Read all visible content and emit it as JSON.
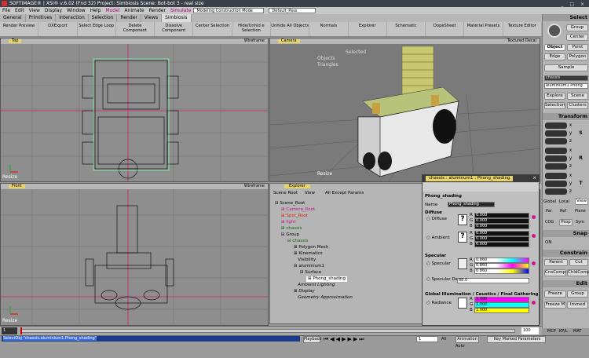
{
  "window": {
    "title": "SOFTIMAGE® | XSI® v.6.02 (Fnd 32) Project: Simbiosis    Scene: Bot-bot 3 - real size"
  },
  "menu": {
    "items": [
      "File",
      "Edit",
      "View",
      "Display",
      "Window",
      "Help",
      "Model",
      "Animate",
      "Render",
      "Simulate"
    ],
    "mode": "Modeling Construction Mode",
    "pass": "Default_Pass"
  },
  "tabs": [
    "General",
    "Primitives",
    "Interaction",
    "Selection",
    "Render",
    "Views",
    "Simbiosis"
  ],
  "toolbar": [
    "Render Preview",
    "DXExport",
    "Select Edge Loop",
    "Delete Component",
    "Dissolve Component",
    "Center Selection",
    "Hide/Unhid e Selection",
    "Unhide All Objects",
    "Normals",
    "Explorer",
    "Schematic",
    "DopeSheet",
    "Material Presets",
    "Texture Editor"
  ],
  "viewports": {
    "top": {
      "name": "Top",
      "mode": "Wireframe",
      "letter": "Resize"
    },
    "camera": {
      "name": "Camera",
      "mode": "Textured Decal",
      "stats": [
        "Selected",
        "Objects",
        "Triangles"
      ],
      "letter": "Resize"
    },
    "front": {
      "name": "Front",
      "mode": "Wireframe",
      "letter": "Resize"
    }
  },
  "explorer": {
    "tabs": [
      "Explorer",
      "Scene Root",
      "View",
      "All Except Params"
    ],
    "nodes": [
      "Scene_Root",
      "Camera_Root",
      "Spot_Root",
      "light",
      "chassis",
      "Group",
      "chassis",
      "Polygon Mesh",
      "Kinematics",
      "Visibility",
      "aluminium1",
      "Surface",
      "Phong_shading",
      "Ambient Lighting",
      "Display",
      "Geometry Approximation"
    ]
  },
  "prop": {
    "title": "chassis : aluminum1 : Phong_shading",
    "subtitle": "Phong_shading",
    "name_label": "Name",
    "name_value": "Phong_shading",
    "diffuse": "Diffuse",
    "diffuse_label": "Diffuse",
    "ambient_label": "Ambient",
    "specular": "Specular",
    "specular_label": "Specular",
    "decay_label": "Specular Decay",
    "decay_value": "88.0",
    "gi": "Global Illumination / Caustics / Final Gathering",
    "radiance_label": "Radiance",
    "rgb": [
      "R",
      "G",
      "B"
    ],
    "zeros": [
      "0.000",
      "0.000",
      "0.000"
    ],
    "spec_vals": [
      "0.860",
      "0.860",
      "0.860"
    ],
    "rad_vals": [
      "1.000",
      "1.000",
      "1.000"
    ]
  },
  "right_panel": {
    "select": "Select",
    "group": "Group",
    "center": "Center",
    "object": "Object",
    "point": "Point",
    "edge": "Edge",
    "polygon": "Polygon",
    "sample": "Sample",
    "sel_name": "chassis",
    "sel_mat": "aluminium1 Phong",
    "explore": "Explore",
    "scene": "Scene",
    "selection": "Selection",
    "clusters": "Clusters",
    "transform": "Transform",
    "axes": [
      "x",
      "y",
      "z"
    ],
    "tr": [
      "S",
      "R",
      "T"
    ],
    "global": "Global",
    "local": "Local",
    "view": "View",
    "par": "Par",
    "ref": "Ref",
    "plane": "Plane",
    "cog": "COG",
    "prop_btn": "Prop",
    "sym": "Sym",
    "snap": "Snap",
    "on": "ON",
    "constrain": "Constrain",
    "parent": "Parent",
    "cut": "Cut",
    "cnscomp": "CnsComp",
    "chldcomp": "ChldComp",
    "edit": "Edit",
    "freeze": "Freeze",
    "group2": "Group",
    "freezem": "Freeze M",
    "immed": "Immed"
  },
  "timeline": {
    "start": "1",
    "end": "100",
    "frame": "100"
  },
  "status": {
    "command": "SelectObj \"chassis.aluminium1.Phong_shading\"",
    "playback": "Playback",
    "frame_field": "1",
    "all": "All",
    "animation": "Animation",
    "auto": "Auto",
    "key_marked": "Key Marked Parameters",
    "mcp": "MCP",
    "kpl": "KP/L",
    "mat": "MAT"
  }
}
